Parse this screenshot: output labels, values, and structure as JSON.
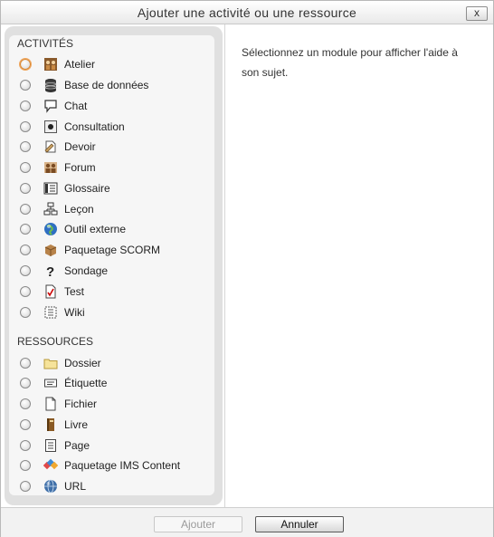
{
  "dialog": {
    "title": "Ajouter une activité ou une ressource",
    "close_label": "x"
  },
  "activities": {
    "heading": "ACTIVITÉS",
    "items": [
      {
        "label": "Atelier",
        "icon": "workshop-icon"
      },
      {
        "label": "Base de données",
        "icon": "database-icon"
      },
      {
        "label": "Chat",
        "icon": "chat-icon"
      },
      {
        "label": "Consultation",
        "icon": "choice-icon"
      },
      {
        "label": "Devoir",
        "icon": "assignment-icon"
      },
      {
        "label": "Forum",
        "icon": "forum-icon"
      },
      {
        "label": "Glossaire",
        "icon": "glossary-icon"
      },
      {
        "label": "Leçon",
        "icon": "lesson-icon"
      },
      {
        "label": "Outil externe",
        "icon": "external-tool-icon"
      },
      {
        "label": "Paquetage SCORM",
        "icon": "scorm-icon"
      },
      {
        "label": "Sondage",
        "icon": "survey-icon"
      },
      {
        "label": "Test",
        "icon": "quiz-icon"
      },
      {
        "label": "Wiki",
        "icon": "wiki-icon"
      }
    ]
  },
  "resources": {
    "heading": "RESSOURCES",
    "items": [
      {
        "label": "Dossier",
        "icon": "folder-icon"
      },
      {
        "label": "Étiquette",
        "icon": "label-icon"
      },
      {
        "label": "Fichier",
        "icon": "file-icon"
      },
      {
        "label": "Livre",
        "icon": "book-icon"
      },
      {
        "label": "Page",
        "icon": "page-icon"
      },
      {
        "label": "Paquetage IMS Content",
        "icon": "ims-package-icon"
      },
      {
        "label": "URL",
        "icon": "url-icon"
      }
    ]
  },
  "help": {
    "text": "Sélectionnez un module pour afficher l'aide à son sujet."
  },
  "footer": {
    "add_label": "Ajouter",
    "cancel_label": "Annuler"
  }
}
